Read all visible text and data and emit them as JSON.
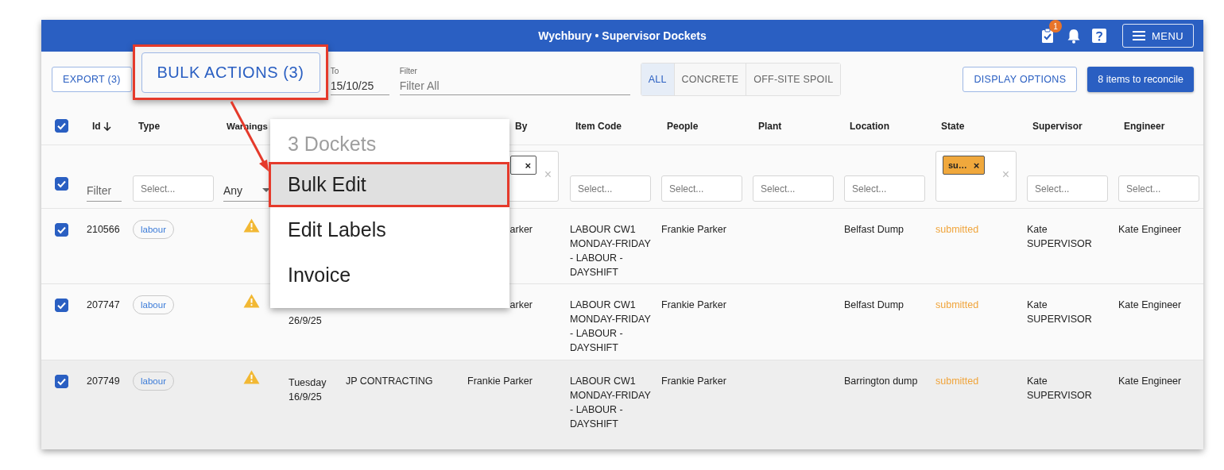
{
  "app_bar": {
    "title": "Wychbury • Supervisor Dockets",
    "tasks_badge": "1",
    "menu_button": "MENU"
  },
  "toolbar": {
    "export_button": "EXPORT (3)",
    "to_field": {
      "label": "To",
      "value": "15/10/25"
    },
    "filter_field": {
      "label": "Filter",
      "placeholder": "Filter All"
    },
    "segments": [
      {
        "label": "ALL",
        "selected": true
      },
      {
        "label": "CONCRETE",
        "selected": false
      },
      {
        "label": "OFF-SITE SPOIL",
        "selected": false
      }
    ],
    "display_options_button": "DISPLAY OPTIONS",
    "reconcile_button": "8 items to reconcile"
  },
  "table": {
    "select_all_checked": true,
    "id_sorted_descending": true,
    "columns": {
      "id": "Id",
      "type": "Type",
      "warnings": "Warnings",
      "by": "By",
      "item_code": "Item Code",
      "people": "People",
      "plant": "Plant",
      "location": "Location",
      "state": "State",
      "supervisor": "Supervisor",
      "engineer": "Engineer"
    },
    "filter_row": {
      "checked": true,
      "id_placeholder": "Filter",
      "warnings_value": "Any",
      "by_chip_remove": "×",
      "by_clear": "×",
      "type_placeholder": "Select...",
      "item_code_placeholder": "Select...",
      "people_placeholder": "Select...",
      "plant_placeholder": "Select...",
      "location_placeholder": "Select...",
      "supervisor_placeholder": "Select...",
      "engineer_placeholder": "Select...",
      "state_chip": {
        "label": "su…",
        "remove": "×",
        "color": "#f0a83c"
      },
      "state_clear": "×"
    },
    "rows": [
      {
        "checked": true,
        "highlighted": false,
        "id": "210566",
        "type": "labour",
        "warning": true,
        "by": "arker",
        "item_code": "LABOUR CW1 MONDAY-FRIDAY - LABOUR - DAYSHIFT",
        "people": "Frankie Parker",
        "location": "Belfast Dump",
        "state": "submitted",
        "supervisor": "Kate SUPERVISOR",
        "engineer": "Kate Engineer"
      },
      {
        "checked": true,
        "highlighted": false,
        "id": "207747",
        "type": "labour",
        "warning": true,
        "date": [
          "26/9/25"
        ],
        "by": "arker",
        "item_code": "LABOUR CW1 MONDAY-FRIDAY - LABOUR - DAYSHIFT",
        "people": "Frankie Parker",
        "location": "Belfast Dump",
        "state": "submitted",
        "supervisor": "Kate SUPERVISOR",
        "engineer": "Kate Engineer"
      },
      {
        "checked": true,
        "highlighted": true,
        "id": "207749",
        "type": "labour",
        "warning": true,
        "date": [
          "Tuesday",
          "16/9/25"
        ],
        "supplier": "JP CONTRACTING",
        "by": "Frankie Parker",
        "item_code": "LABOUR CW1 MONDAY-FRIDAY - LABOUR - DAYSHIFT",
        "people": "Frankie Parker",
        "location": "Barrington dump",
        "state": "submitted",
        "supervisor": "Kate SUPERVISOR",
        "engineer": "Kate Engineer"
      }
    ]
  },
  "menu": {
    "header": "3 Dockets",
    "items": [
      {
        "label": "Bulk Edit",
        "selected": true
      },
      {
        "label": "Edit Labels",
        "selected": false
      },
      {
        "label": "Invoice",
        "selected": false
      }
    ]
  },
  "callout": {
    "button": "BULK ACTIONS (3)"
  }
}
